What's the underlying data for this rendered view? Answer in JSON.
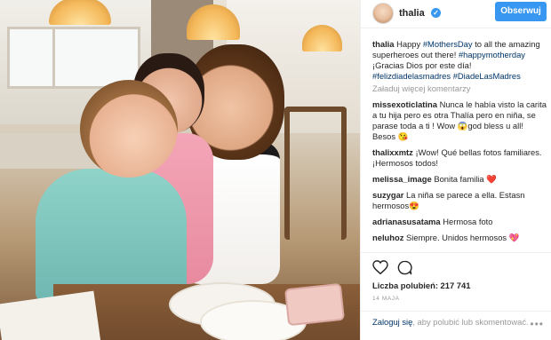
{
  "post": {
    "username": "thalia",
    "follow_label": "Obserwuj",
    "caption": {
      "user": "thalia",
      "part1": "Happy ",
      "tag1": "#MothersDay",
      "part2": " to all the amazing superheroes out there! ",
      "tag2": "#happymotherday",
      "part3": " ¡Gracias Dios por este día! ",
      "tag3": "#felizdiadelasmadres",
      "tag4": "#DiadeLasMadres"
    },
    "load_more": "Załaduj więcej komentarzy",
    "comments": [
      {
        "user": "missexoticlatina",
        "text": "Nunca le había visto la carita a tu hija pero es otra Thalía pero en niña, se parase toda a ti ! Wow 😱god bless u all! Besos 😘"
      },
      {
        "user": "thalixxmtz",
        "text": "¡Wow! Qué bellas fotos familiares. ¡Hermosos todos!"
      },
      {
        "user": "melissa_image",
        "text": "Bonita familia ❤️"
      },
      {
        "user": "suzygar",
        "text": "La niña se parece a ella. Estasn hermosos😍"
      },
      {
        "user": "adrianasusatama",
        "text": "Hermosa foto"
      },
      {
        "user": "neluhoz",
        "text": "Siempre. Unidos hermosos 💖"
      }
    ],
    "likes": "Liczba polubień: 217 741",
    "date": "14 MAJA",
    "login": {
      "link": "Zaloguj się",
      "text": ", aby polubić lub skomentować."
    },
    "more_options": "•••"
  },
  "colors": {
    "accent": "#3897f0",
    "hashtag": "#003569",
    "muted": "#999999"
  }
}
